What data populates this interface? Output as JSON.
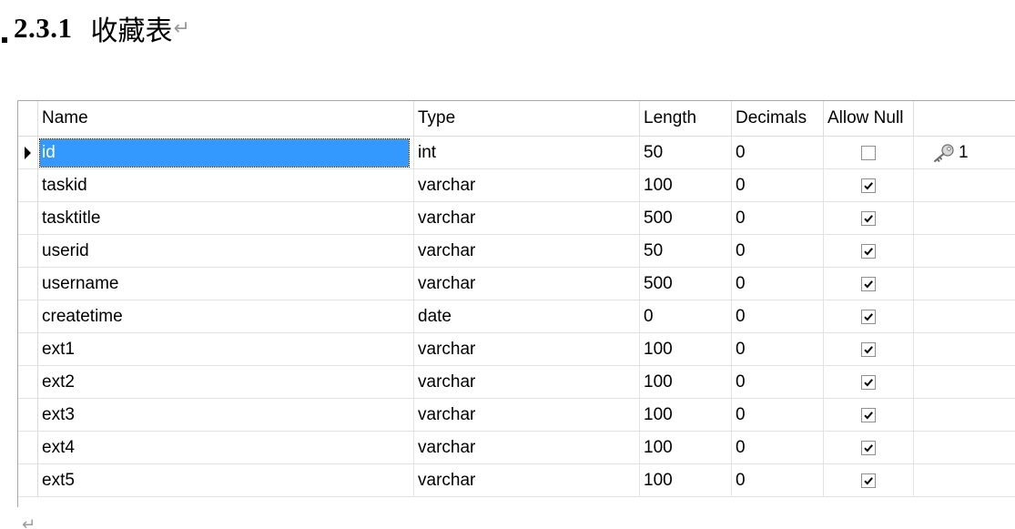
{
  "heading": {
    "number": "2.3.1",
    "title": "收藏表",
    "paragraph_mark": "↵"
  },
  "table": {
    "columns": [
      "Name",
      "Type",
      "Length",
      "Decimals",
      "Allow Null"
    ],
    "rows": [
      {
        "name": "id",
        "type": "int",
        "length": "50",
        "decimals": "0",
        "allow_null": false,
        "key": "1",
        "selected": true
      },
      {
        "name": "taskid",
        "type": "varchar",
        "length": "100",
        "decimals": "0",
        "allow_null": true,
        "key": ""
      },
      {
        "name": "tasktitle",
        "type": "varchar",
        "length": "500",
        "decimals": "0",
        "allow_null": true,
        "key": ""
      },
      {
        "name": "userid",
        "type": "varchar",
        "length": "50",
        "decimals": "0",
        "allow_null": true,
        "key": ""
      },
      {
        "name": "username",
        "type": "varchar",
        "length": "500",
        "decimals": "0",
        "allow_null": true,
        "key": ""
      },
      {
        "name": "createtime",
        "type": "date",
        "length": "0",
        "decimals": "0",
        "allow_null": true,
        "key": ""
      },
      {
        "name": "ext1",
        "type": "varchar",
        "length": "100",
        "decimals": "0",
        "allow_null": true,
        "key": ""
      },
      {
        "name": "ext2",
        "type": "varchar",
        "length": "100",
        "decimals": "0",
        "allow_null": true,
        "key": ""
      },
      {
        "name": "ext3",
        "type": "varchar",
        "length": "100",
        "decimals": "0",
        "allow_null": true,
        "key": ""
      },
      {
        "name": "ext4",
        "type": "varchar",
        "length": "100",
        "decimals": "0",
        "allow_null": true,
        "key": ""
      },
      {
        "name": "ext5",
        "type": "varchar",
        "length": "100",
        "decimals": "0",
        "allow_null": true,
        "key": ""
      }
    ]
  },
  "icons": {
    "row_pointer": "row-pointer-icon",
    "primary_key": "primary-key-icon",
    "checkbox": "checkbox-icon"
  },
  "colors": {
    "selection": "#3399ff",
    "grid_line": "#e2e2e2",
    "paragraph_mark": "#9a9a9a"
  }
}
